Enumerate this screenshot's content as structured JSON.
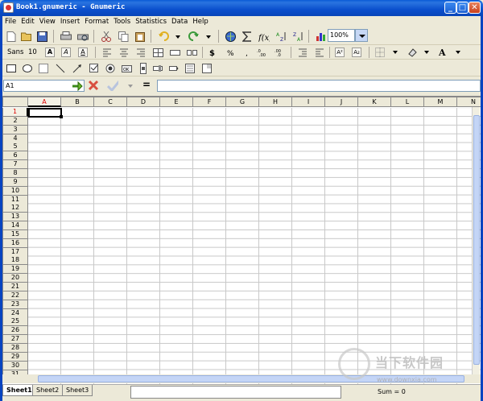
{
  "window": {
    "title": "Book1.gnumeric - Gnumeric",
    "controls": {
      "minimize": "_",
      "maximize": "□",
      "close": "✕"
    }
  },
  "menu": [
    "File",
    "Edit",
    "View",
    "Insert",
    "Format",
    "Tools",
    "Statistics",
    "Data",
    "Help"
  ],
  "toolbar": {
    "zoom": "100%",
    "font_name": "Sans",
    "font_size": "10"
  },
  "formula_bar": {
    "cell_ref": "A1",
    "equals": "=",
    "value": ""
  },
  "grid": {
    "columns": [
      "A",
      "B",
      "C",
      "D",
      "E",
      "F",
      "G",
      "H",
      "I",
      "J",
      "K",
      "L",
      "M",
      "N"
    ],
    "rows": [
      "1",
      "2",
      "3",
      "4",
      "5",
      "6",
      "7",
      "8",
      "9",
      "10",
      "11",
      "12",
      "13",
      "14",
      "15",
      "16",
      "17",
      "18",
      "19",
      "20",
      "21",
      "22",
      "23",
      "24",
      "25",
      "26",
      "27",
      "28",
      "29",
      "30",
      "31"
    ],
    "active_cell": "A1"
  },
  "sheets": [
    "Sheet1",
    "Sheet2",
    "Sheet3"
  ],
  "active_sheet": "Sheet1",
  "status": {
    "sum": "Sum = 0"
  },
  "watermark": {
    "text": "当下软件园",
    "url": "www.downxia.com"
  },
  "colors": {
    "titlebar": "#0a4fcd",
    "active_header": "#dd0000",
    "chrome": "#ece9d8"
  }
}
